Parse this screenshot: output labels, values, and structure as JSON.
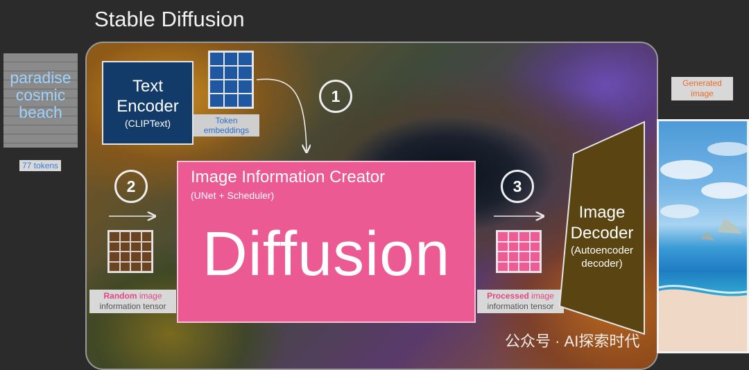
{
  "title": "Stable Diffusion",
  "prompt": {
    "lines": [
      "paradise",
      "cosmic",
      "beach"
    ],
    "token_count": "77 tokens"
  },
  "text_encoder": {
    "title_line1": "Text",
    "title_line2": "Encoder",
    "subtitle": "(CLIPText)"
  },
  "token_embeddings": {
    "label_line1": "Token",
    "label_line2": "embeddings"
  },
  "steps": [
    "1",
    "2",
    "3"
  ],
  "creator": {
    "title": "Image Information Creator",
    "subtitle": "(UNet + Scheduler)",
    "big_text": "Diffusion"
  },
  "random_tensor": {
    "highlight": "Random",
    "rest": " image",
    "line2": "information tensor"
  },
  "processed_tensor": {
    "highlight": "Processed",
    "rest": " image",
    "line2": "information tensor"
  },
  "decoder": {
    "line1": "Image",
    "line2": "Decoder",
    "sub1": "(Autoencoder",
    "sub2": "decoder)"
  },
  "generated": {
    "line1": "Generated",
    "line2": "image"
  },
  "watermark": "公众号 · AI探索时代",
  "colors": {
    "encoder": "#123b6a",
    "creator": "#ec5a93",
    "decoder": "#5a4411",
    "token_grid": "#1f58a0"
  }
}
